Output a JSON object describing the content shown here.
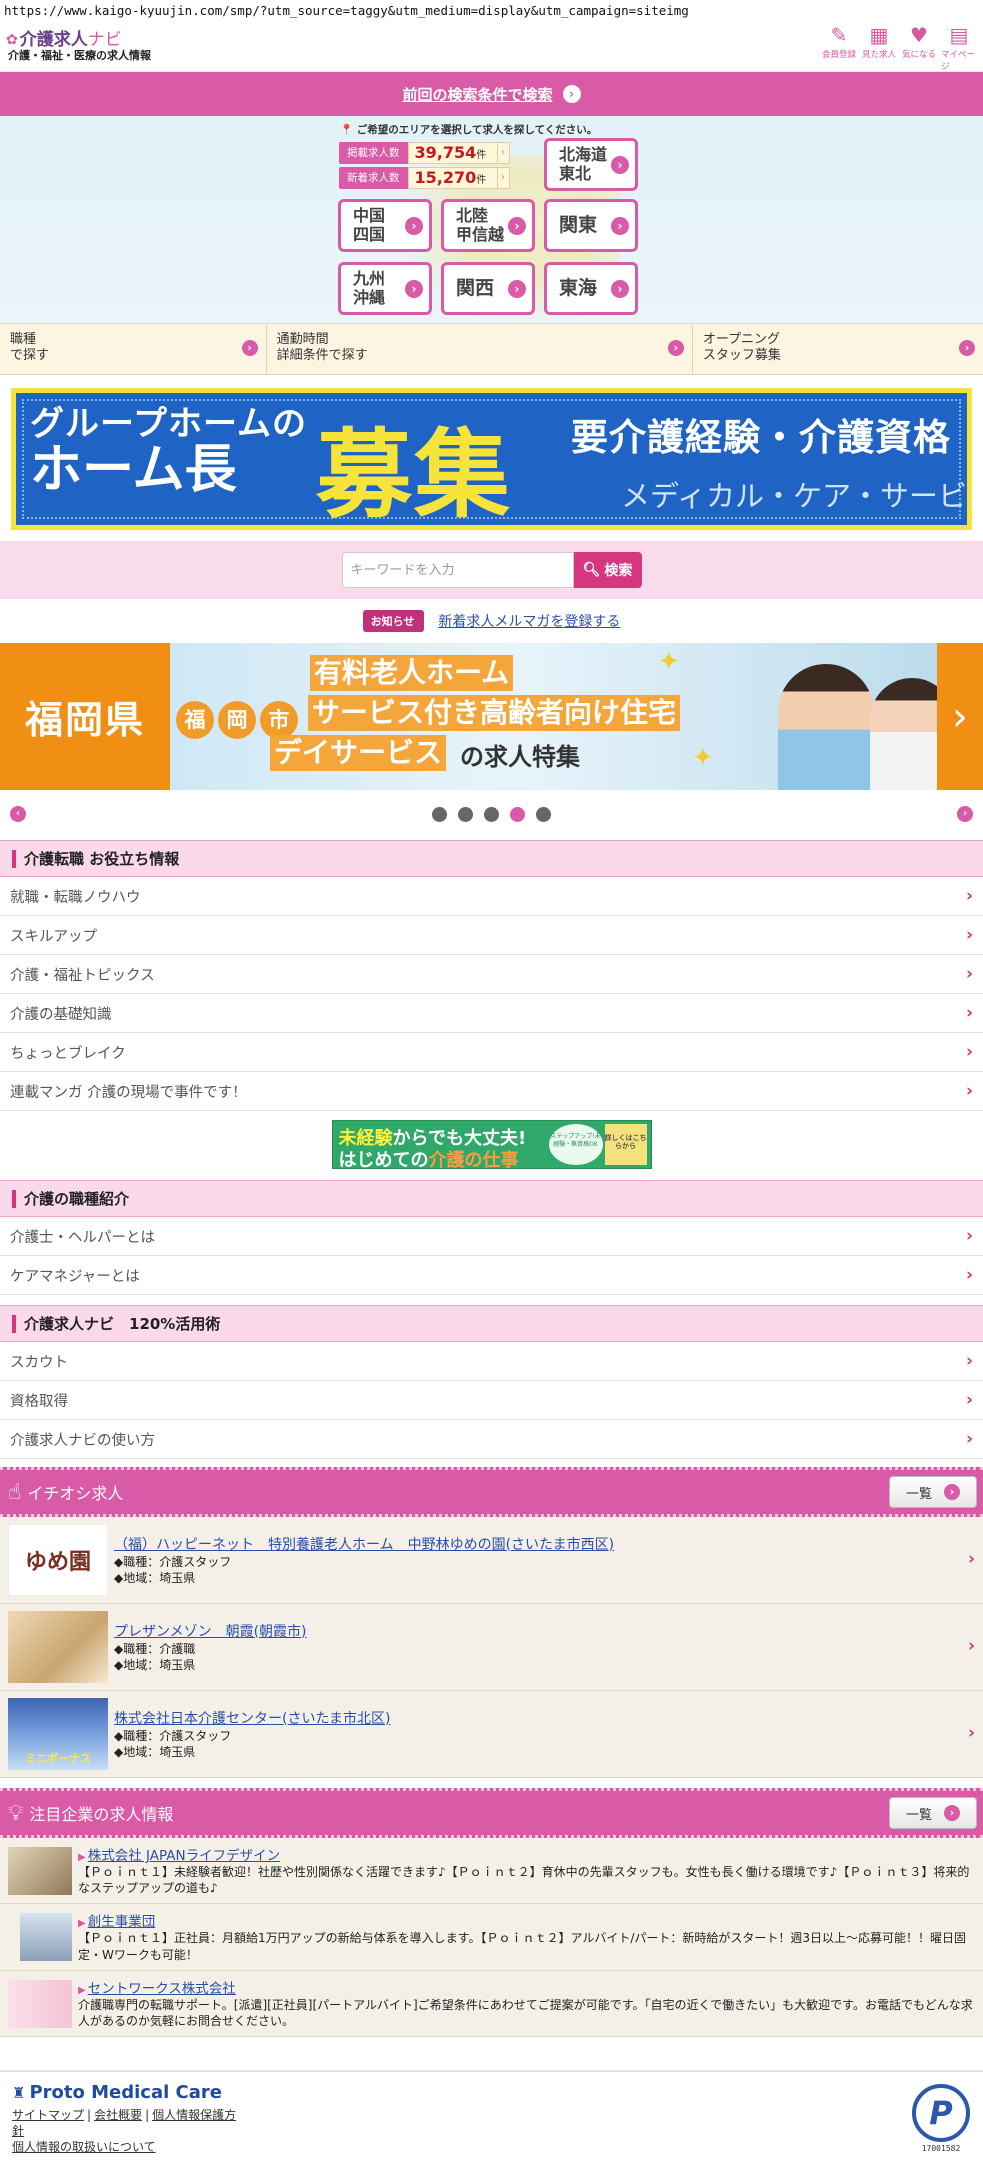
{
  "url": "https://www.kaigo-kyuujin.com/smp/?utm_source=taggy&utm_medium=display&utm_campaign=siteimg",
  "header": {
    "logo_mark": "✿",
    "logo_name": "介護求人",
    "logo_navi": "ナビ",
    "logo_sub": "介護・福祉・医療の求人情報",
    "icons": [
      {
        "icon": "pencil-icon",
        "glyph": "✎",
        "label": "会員登録"
      },
      {
        "icon": "calendar-icon",
        "glyph": "▦",
        "label": "見た求人"
      },
      {
        "icon": "heart-icon",
        "glyph": "♥",
        "label": "気になる"
      },
      {
        "icon": "mypage-icon",
        "glyph": "▤",
        "label": "マイページ"
      }
    ]
  },
  "prev_search": {
    "label": "前回の検索条件で検索"
  },
  "area": {
    "hint": "ご希望のエリアを選択して求人を探してください。",
    "published_label": "掲載求人数",
    "published_value": "39,754",
    "new_label": "新着求人数",
    "new_value": "15,270",
    "unit": "件",
    "regions": {
      "hokkaido": "北海道\n東北",
      "chugoku": "中国\n四国",
      "hokuriku": "北陸\n甲信越",
      "kanto": "関東",
      "kyushu": "九州\n沖縄",
      "kansai": "関西",
      "tokai": "東海"
    }
  },
  "conditions": [
    {
      "label": "職種\nで探す"
    },
    {
      "label": "通勤時間\n詳細条件で探す"
    },
    {
      "label": "オープニング\nスタッフ募集"
    }
  ],
  "banner1": {
    "line1": "グループホームの",
    "line2": "ホーム長",
    "big": "募集",
    "right1": "要介護経験・介護資格",
    "right2": "メディカル・ケア・サービス"
  },
  "search": {
    "placeholder": "キーワードを入力",
    "button": "検索"
  },
  "notice": {
    "badge": "お知らせ",
    "link": "新着求人メルマガを登録する"
  },
  "slide": {
    "pref": "福岡県",
    "city": [
      "福",
      "岡",
      "市"
    ],
    "line1": "有料老人ホーム",
    "line2": "サービス付き高齢者向け住宅",
    "line3": "デイサービス",
    "line3_tail": "の求人特集"
  },
  "pager": {
    "dots": 5,
    "active_index": 3
  },
  "sections": {
    "tips": {
      "title": "介護転職 お役立ち情報",
      "items": [
        "就職・転職ノウハウ",
        "スキルアップ",
        "介護・福祉トピックス",
        "介護の基礎知識",
        "ちょっとブレイク",
        "連載マンガ 介護の現場で事件です！"
      ]
    },
    "mini_banner": {
      "m1_b": "未経験",
      "m1": "からでも大丈夫!",
      "m2a": "はじめての",
      "m2_b": "介護の仕事",
      "badge": "詳しくはこちらから",
      "circle": "ステップアップ!未経験・無資格OK"
    },
    "jobtypes": {
      "title": "介護の職種紹介",
      "items": [
        "介護士・ヘルパーとは",
        "ケアマネジャーとは"
      ]
    },
    "howto": {
      "title": "介護求人ナビ　120%活用術",
      "items": [
        "スカウト",
        "資格取得",
        "介護求人ナビの使い方"
      ]
    }
  },
  "pickup": {
    "title": "イチオシ求人",
    "list_button": "一覧",
    "jobs": [
      {
        "title": "（福）ハッピーネット　特別養護老人ホーム　中野林ゆめの園(さいたま市西区)",
        "type": "◆職種：介護スタッフ",
        "area": "◆地域：埼玉県",
        "thumb_text": "ゆめ園"
      },
      {
        "title": "プレザンメゾン　朝霞(朝霞市)",
        "type": "◆職種：介護職",
        "area": "◆地域：埼玉県",
        "thumb_text": ""
      },
      {
        "title": "株式会社日本介護センター(さいたま市北区)",
        "type": "◆職種：介護スタッフ",
        "area": "◆地域：埼玉県",
        "thumb_text": "ミニボーナス"
      }
    ]
  },
  "companies": {
    "title": "注目企業の求人情報",
    "list_button": "一覧",
    "items": [
      {
        "name": "株式会社 JAPANライフデザイン",
        "desc": "【Ｐｏｉｎｔ１】未経験者歓迎！社歴や性別関係なく活躍できます♪【Ｐｏｉｎｔ２】育休中の先輩スタッフも。女性も長く働ける環境です♪【Ｐｏｉｎｔ３】将来的なステップアップの道も♪"
      },
      {
        "name": "創生事業団",
        "desc": "【Ｐｏｉｎｔ１】正社員：月額給1万円アップの新給与体系を導入します。【Ｐｏｉｎｔ２】アルバイト/パート：新時給がスタート！週3日以上～応募可能！！曜日固定・Wワークも可能！"
      },
      {
        "name": "セントワークス株式会社",
        "desc": "介護職専門の転職サポート。[派遣][正社員][パートアルバイト]ご希望条件にあわせてご提案が可能です。「自宅の近くで働きたい」も大歓迎です。お電話でもどんな求人があるのか気軽にお問合せください。"
      }
    ]
  },
  "footer": {
    "brand": "Proto Medical Care",
    "links": [
      "サイトマップ",
      "会社概要",
      "個人情報保護方針",
      "個人情報の取扱いについて"
    ],
    "privacy_num": "17001582"
  },
  "colors": {
    "accent": "#d95aa6",
    "brand_purple": "#6b3e8a",
    "link": "#2a4fa8"
  }
}
